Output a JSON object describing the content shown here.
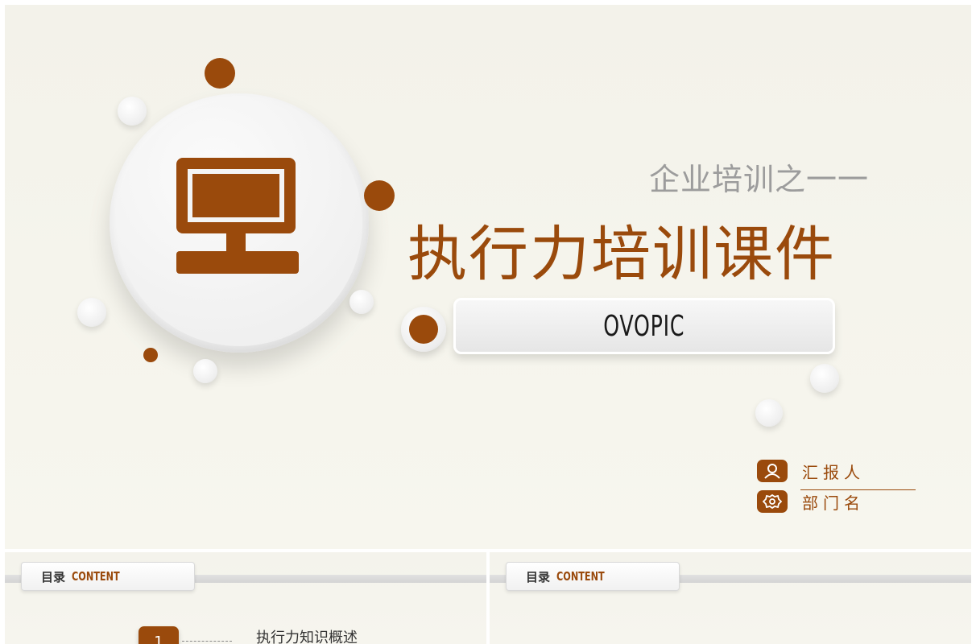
{
  "main_slide": {
    "subtitle": "企业培训之一一",
    "title": "执行力培训课件",
    "name_box_text": "OVOPIC",
    "icon": "monitor-icon",
    "reporter_label": "汇报人",
    "department_label": "部门名",
    "colors": {
      "accent": "#9a4a0c",
      "background": "#f5f4ec",
      "subtitle": "#9c9c9c"
    }
  },
  "thumbnails": [
    {
      "tab_cn": "目录",
      "tab_en": "CONTENT",
      "item_number": "1",
      "item_text": "执行力知识概述"
    },
    {
      "tab_cn": "目录",
      "tab_en": "CONTENT"
    }
  ]
}
